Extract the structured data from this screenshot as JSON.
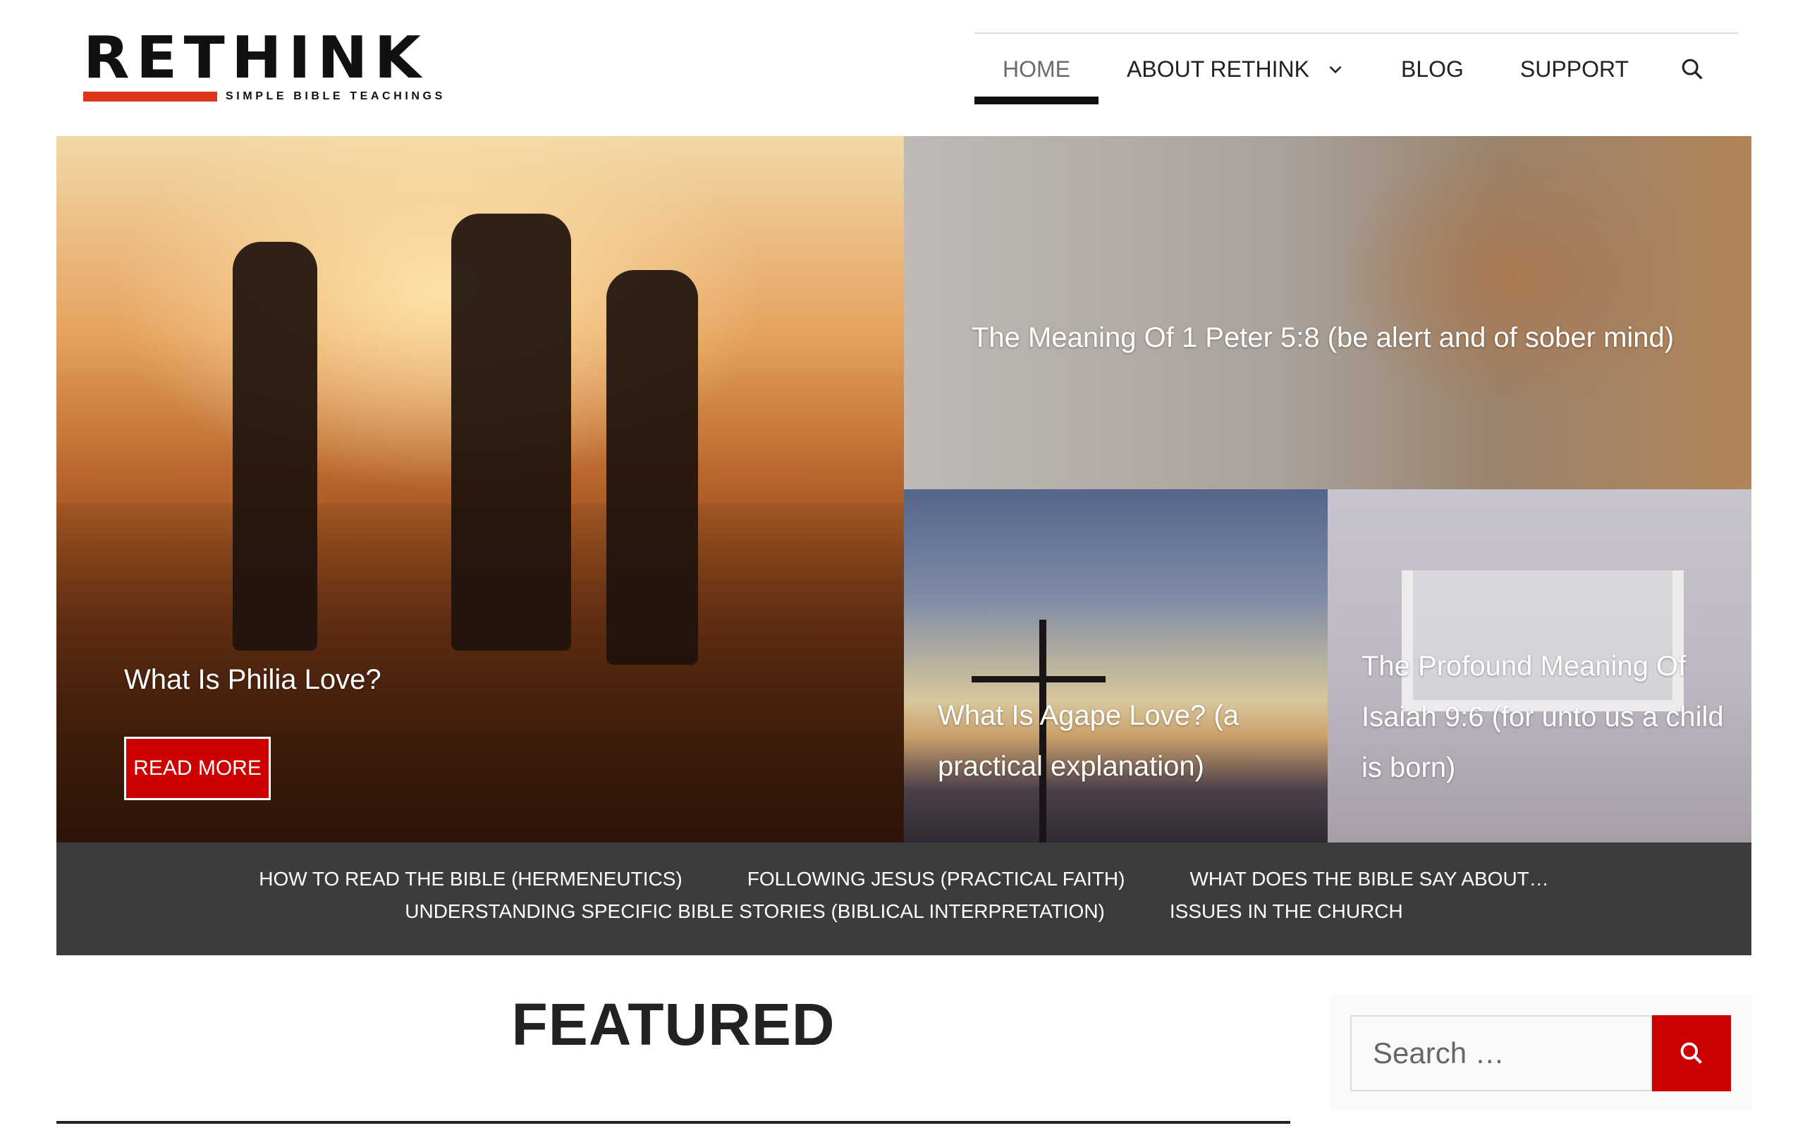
{
  "site": {
    "logo_text": "RETHINK",
    "tagline": "SIMPLE BIBLE TEACHINGS",
    "accent_color": "#d9361a"
  },
  "nav": {
    "items": [
      {
        "label": "HOME",
        "active": true
      },
      {
        "label": "ABOUT RETHINK",
        "has_dropdown": true
      },
      {
        "label": "BLOG"
      },
      {
        "label": "SUPPORT"
      }
    ],
    "search_icon": "search-icon"
  },
  "hero": {
    "main": {
      "title": "What Is Philia Love?",
      "button": "READ MORE"
    },
    "top_right": {
      "title": "The Meaning Of 1 Peter 5:8 (be alert and of sober mind)"
    },
    "bottom_left": {
      "title": "What Is Agape Love? (a practical explanation)"
    },
    "bottom_right": {
      "title": "The Profound Meaning Of Isaiah 9:6 (for unto us a child is born)"
    },
    "button_color": "#cc0000"
  },
  "categories": {
    "row1": [
      "HOW TO READ THE BIBLE (HERMENEUTICS)",
      "FOLLOWING JESUS (PRACTICAL FAITH)",
      "WHAT DOES THE BIBLE SAY ABOUT…"
    ],
    "row2": [
      "UNDERSTANDING SPECIFIC BIBLE STORIES (BIBLICAL INTERPRETATION)",
      "ISSUES IN THE CHURCH"
    ]
  },
  "main": {
    "section_title": "FEATURED"
  },
  "sidebar": {
    "search_placeholder": "Search …",
    "search_icon": "search-icon"
  }
}
